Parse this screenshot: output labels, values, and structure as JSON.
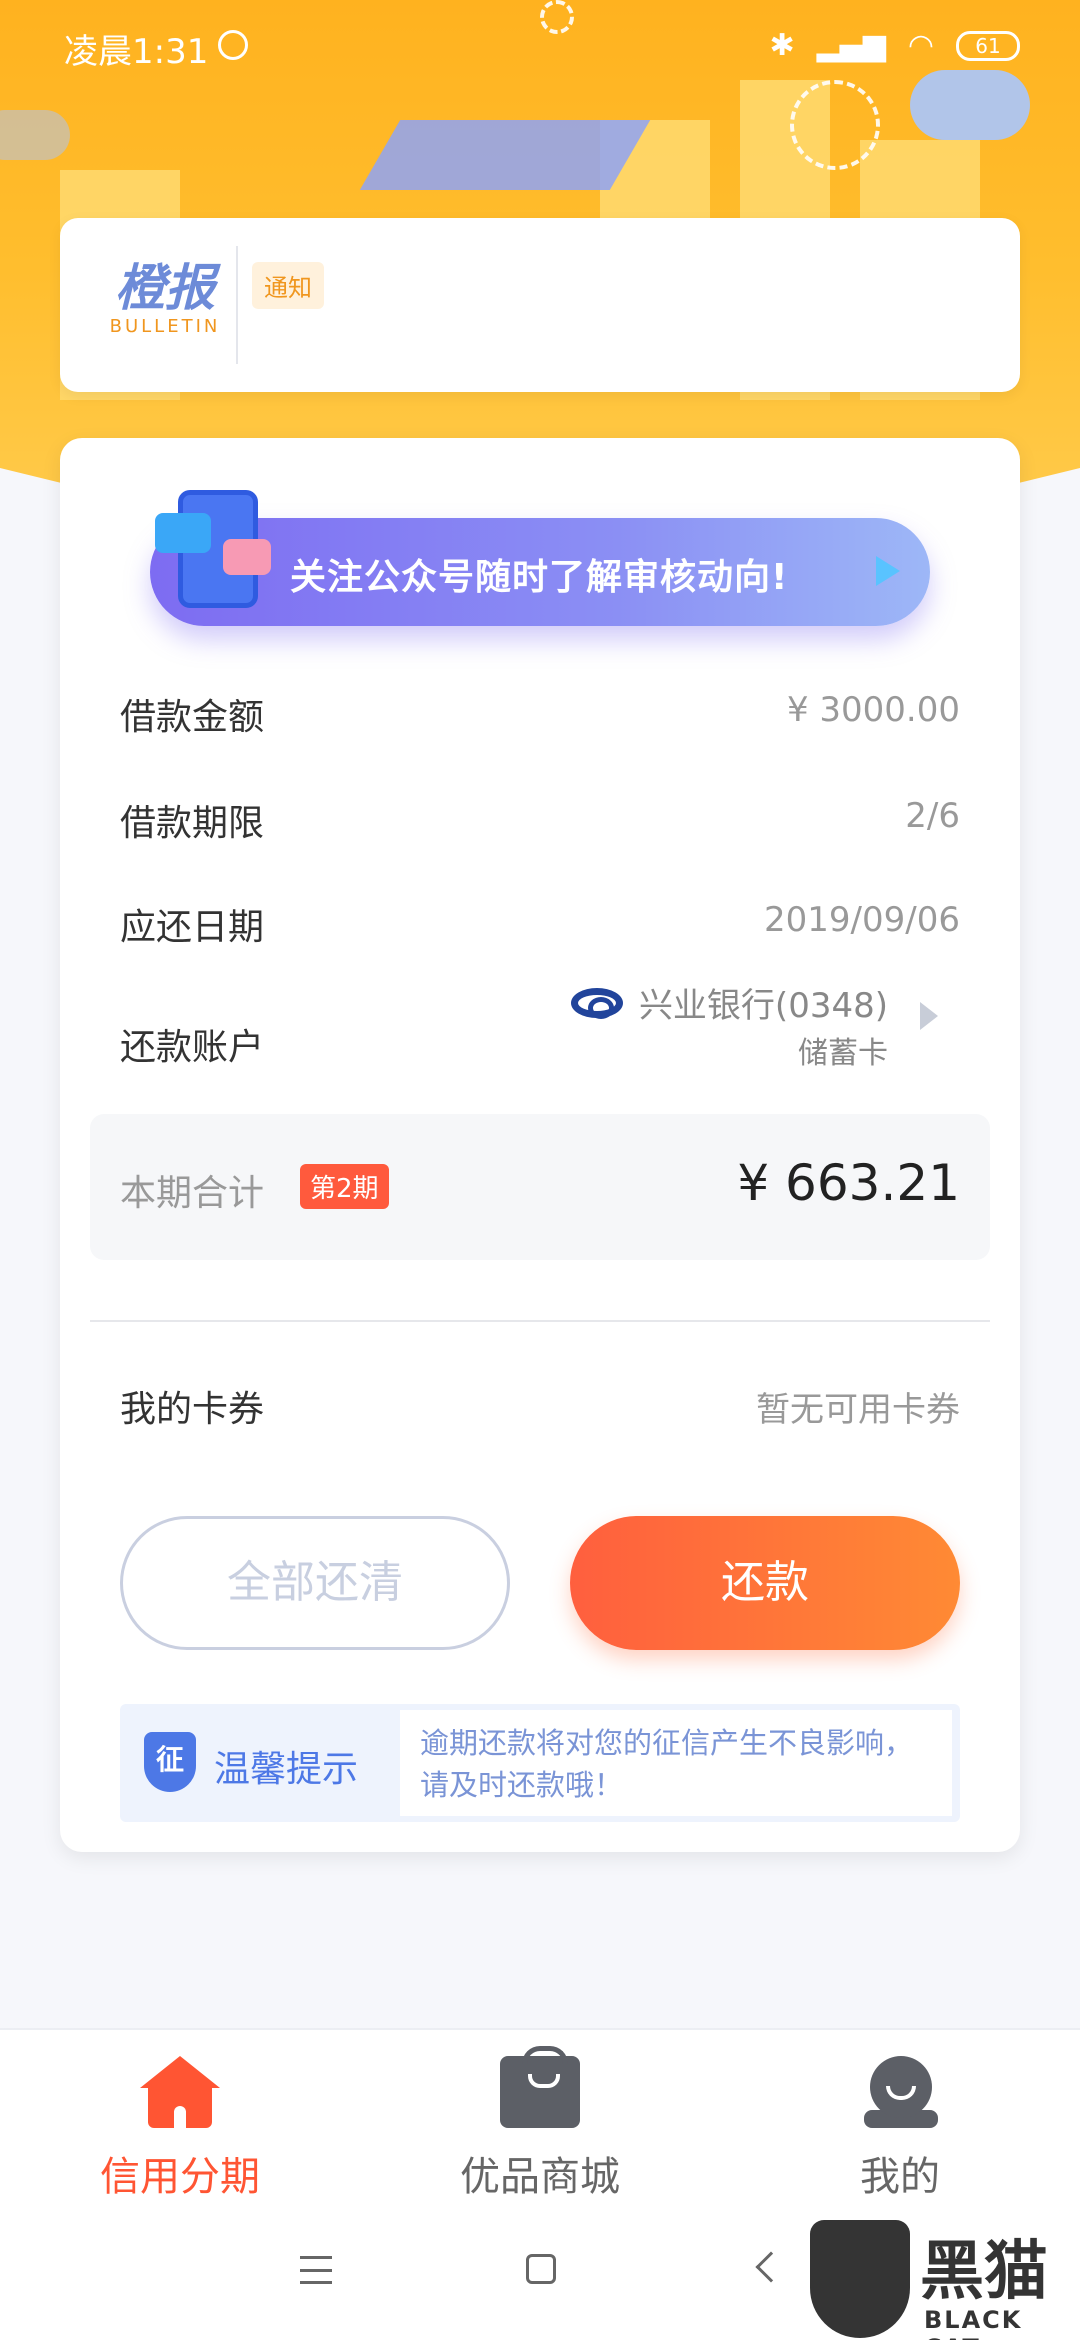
{
  "status_bar": {
    "time": "凌晨1:31",
    "battery": "61"
  },
  "bulletin": {
    "logo_cn": "橙报",
    "logo_en": "BULLETIN",
    "tag": "通知"
  },
  "promo": {
    "text": "关注公众号随时了解审核动向!"
  },
  "loan": {
    "amount_label": "借款金额",
    "amount_value": "¥ 3000.00",
    "term_label": "借款期限",
    "term_value": "2/6",
    "due_label": "应还日期",
    "due_value": "2019/09/06",
    "account_label": "还款账户",
    "account_bank": "兴业银行(0348)",
    "account_type": "储蓄卡"
  },
  "total": {
    "label": "本期合计",
    "badge": "第2期",
    "amount": "¥ 663.21"
  },
  "coupon": {
    "label": "我的卡券",
    "value": "暂无可用卡券"
  },
  "buttons": {
    "clear_all": "全部还清",
    "repay": "还款"
  },
  "tip": {
    "icon_char": "征",
    "title": "温馨提示",
    "message": "逾期还款将对您的征信产生不良影响，请及时还款哦！"
  },
  "tabs": [
    {
      "label": "信用分期",
      "active": true
    },
    {
      "label": "优品商城",
      "active": false
    },
    {
      "label": "我的",
      "active": false
    }
  ],
  "watermark": {
    "cn": "黑猫",
    "en": "BLACK CAT"
  },
  "colors": {
    "accent": "#ff5533",
    "hero": "#ffb21f",
    "promo": "#7d6cf2",
    "tip": "#4d78e6"
  }
}
